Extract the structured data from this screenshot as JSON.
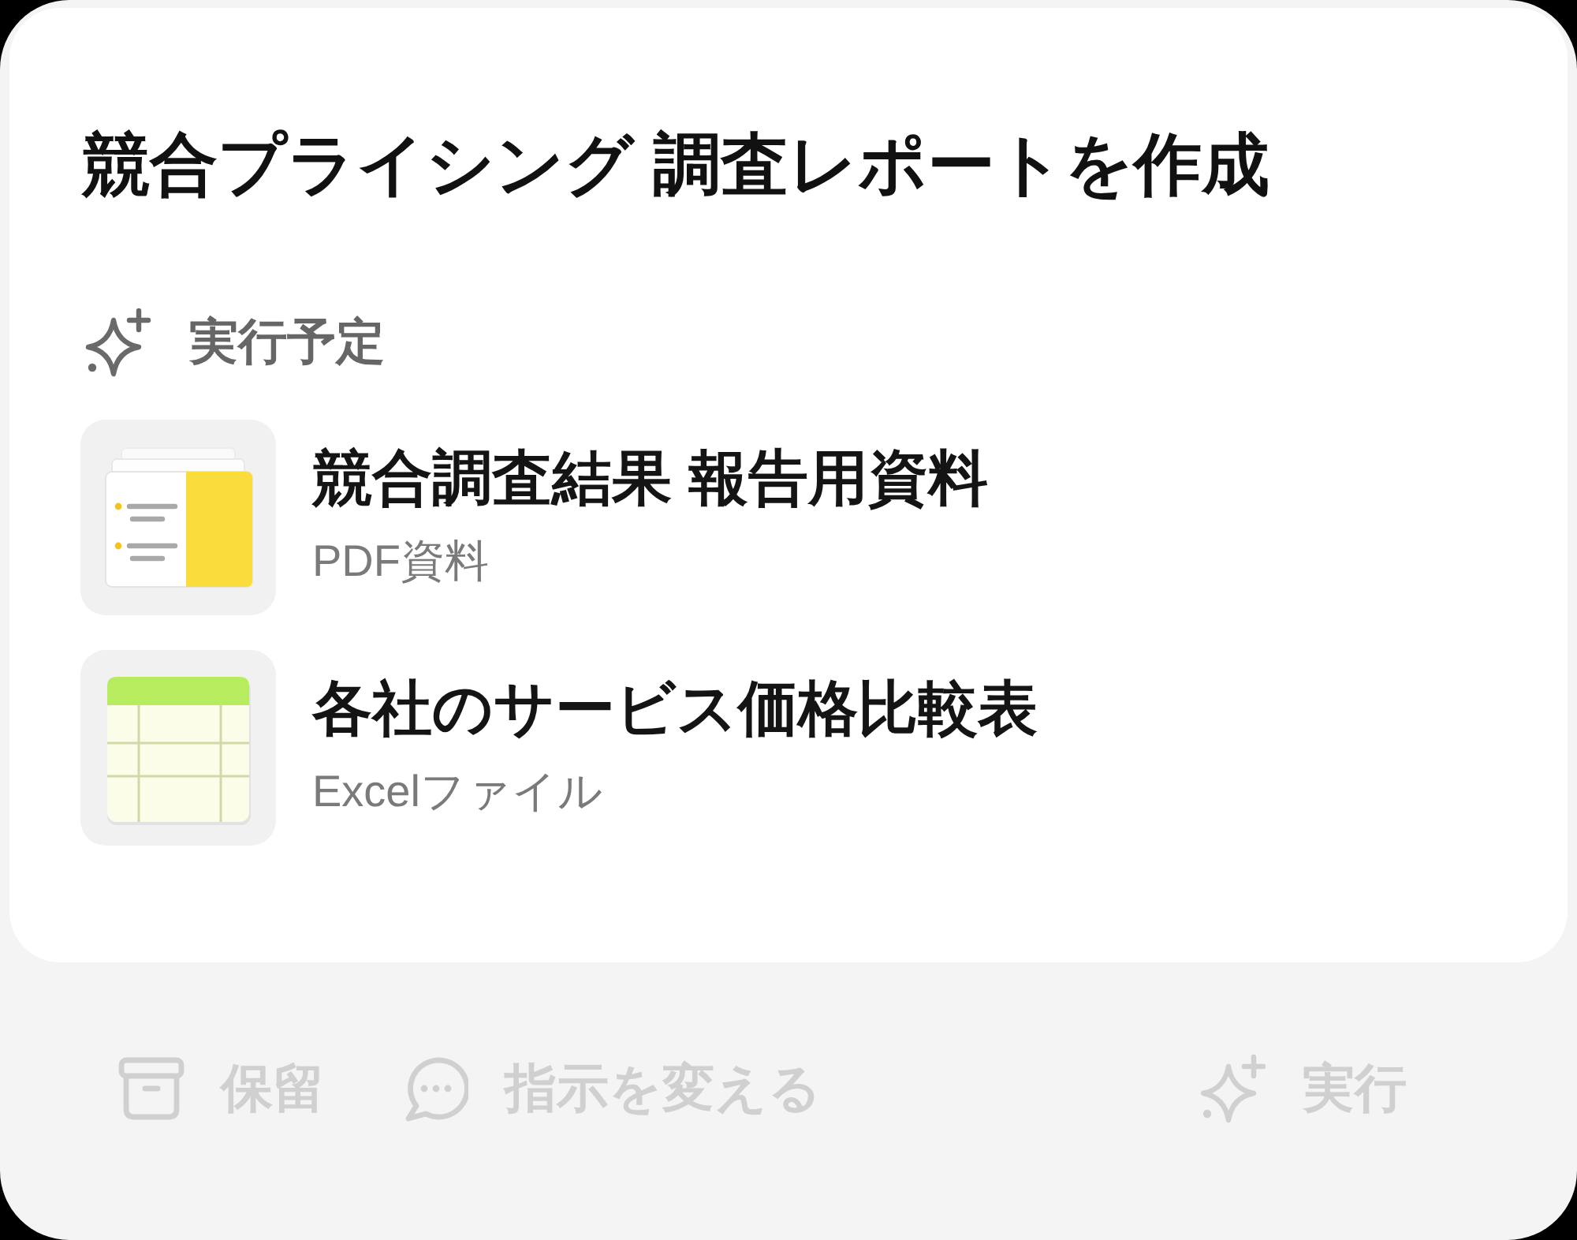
{
  "card": {
    "title": "競合プライシング 調査レポートを作成",
    "section_label": "実行予定",
    "items": [
      {
        "kind": "document",
        "title": "競合調査結果 報告用資料",
        "subtitle": "PDF資料"
      },
      {
        "kind": "spreadsheet",
        "title": "各社のサービス価格比較表",
        "subtitle": "Excelファイル"
      }
    ]
  },
  "footer": {
    "hold_button": {
      "label": "保留",
      "disabled": true
    },
    "revise_button": {
      "label": "指示を変える",
      "disabled": true
    },
    "run_button": {
      "label": "実行",
      "disabled": true
    }
  }
}
